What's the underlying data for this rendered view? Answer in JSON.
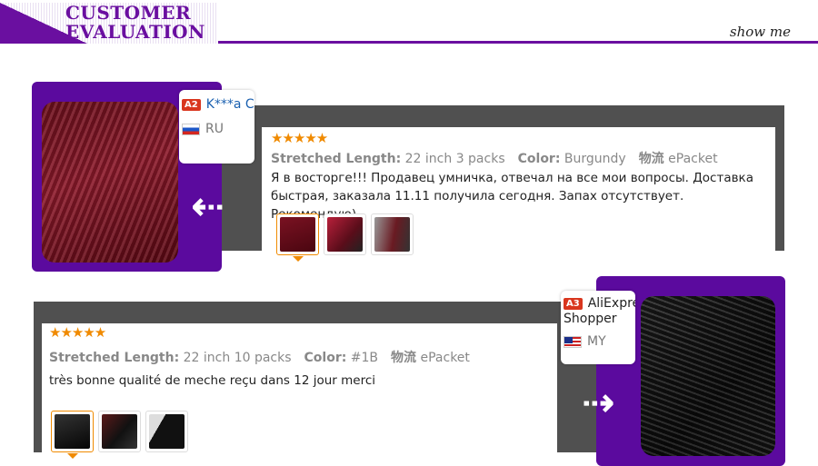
{
  "header": {
    "title_line1": "CUSTOMER",
    "title_line2": "EVALUATION",
    "show_me": "show me"
  },
  "colors": {
    "brand_purple": "#5b0a9e",
    "star_orange": "#f08a00",
    "badge_red": "#d9361e"
  },
  "reviews": [
    {
      "user": {
        "level": "A2",
        "name": "K***a C",
        "country": "RU",
        "flag_icon": "russia-flag-icon"
      },
      "stars": "★★★★★",
      "rating": 5,
      "length_label": "Stretched Length:",
      "length_value": "22 inch 3 packs",
      "color_label": "Color:",
      "color_value": "Burgundy",
      "shipping_label": "物流",
      "shipping_value": "ePacket",
      "text": "Я в восторге!!! Продавец умничка, отвечал на все мои вопросы. Доставка быстрая, заказала 11.11 получила сегодня. Запах отсутствует. Рекомендую)"
    },
    {
      "user": {
        "level": "A3",
        "name": "AliExpre",
        "name_line2": "Shopper",
        "country": "MY",
        "flag_icon": "malaysia-flag-icon"
      },
      "stars": "★★★★★",
      "rating": 5,
      "length_label": "Stretched Length:",
      "length_value": "22 inch 10 packs",
      "color_label": "Color:",
      "color_value": "#1B",
      "shipping_label": "物流",
      "shipping_value": "ePacket",
      "text": "très bonne qualité de meche reçu dans 12 jour merci"
    }
  ]
}
